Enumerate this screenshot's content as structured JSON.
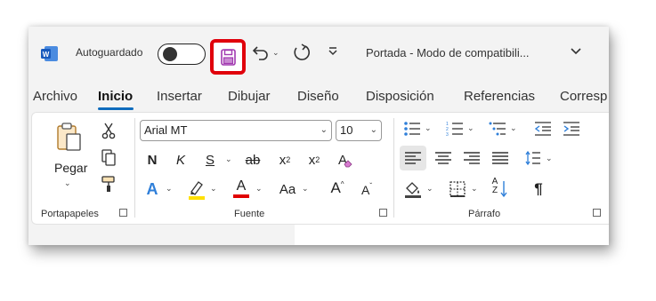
{
  "titlebar": {
    "app_icon": "word-logo-icon",
    "autosave_label": "Autoguardado",
    "autosave_state": "off",
    "document_title": "Portada  -  Modo de compatibili...",
    "highlight_color": "#e0000b"
  },
  "tabs": [
    {
      "label": "Archivo"
    },
    {
      "label": "Inicio",
      "active": true
    },
    {
      "label": "Insertar"
    },
    {
      "label": "Dibujar"
    },
    {
      "label": "Diseño"
    },
    {
      "label": "Disposición"
    },
    {
      "label": "Referencias"
    },
    {
      "label": "Corresp"
    }
  ],
  "clipboard": {
    "paste_label": "Pegar",
    "group_label": "Portapapeles"
  },
  "font": {
    "font_name": "Arial MT",
    "font_size": "10",
    "bold": "N",
    "italic": "K",
    "underline": "S",
    "strike": "ab",
    "subscript": "x",
    "subscript_mark": "2",
    "superscript": "x",
    "superscript_mark": "2",
    "clear_format": "A",
    "text_effects": "A",
    "font_color": "A",
    "change_case": "Aa",
    "grow_font": "A",
    "shrink_font": "A",
    "group_label": "Fuente",
    "highlight_swatch": "#ffe000",
    "font_color_swatch": "#e00000",
    "effects_color": "#2f7fd9"
  },
  "paragraph": {
    "sort_label": "A Z",
    "pilcrow": "¶",
    "group_label": "Párrafo",
    "accent": "#2f7fd9"
  }
}
